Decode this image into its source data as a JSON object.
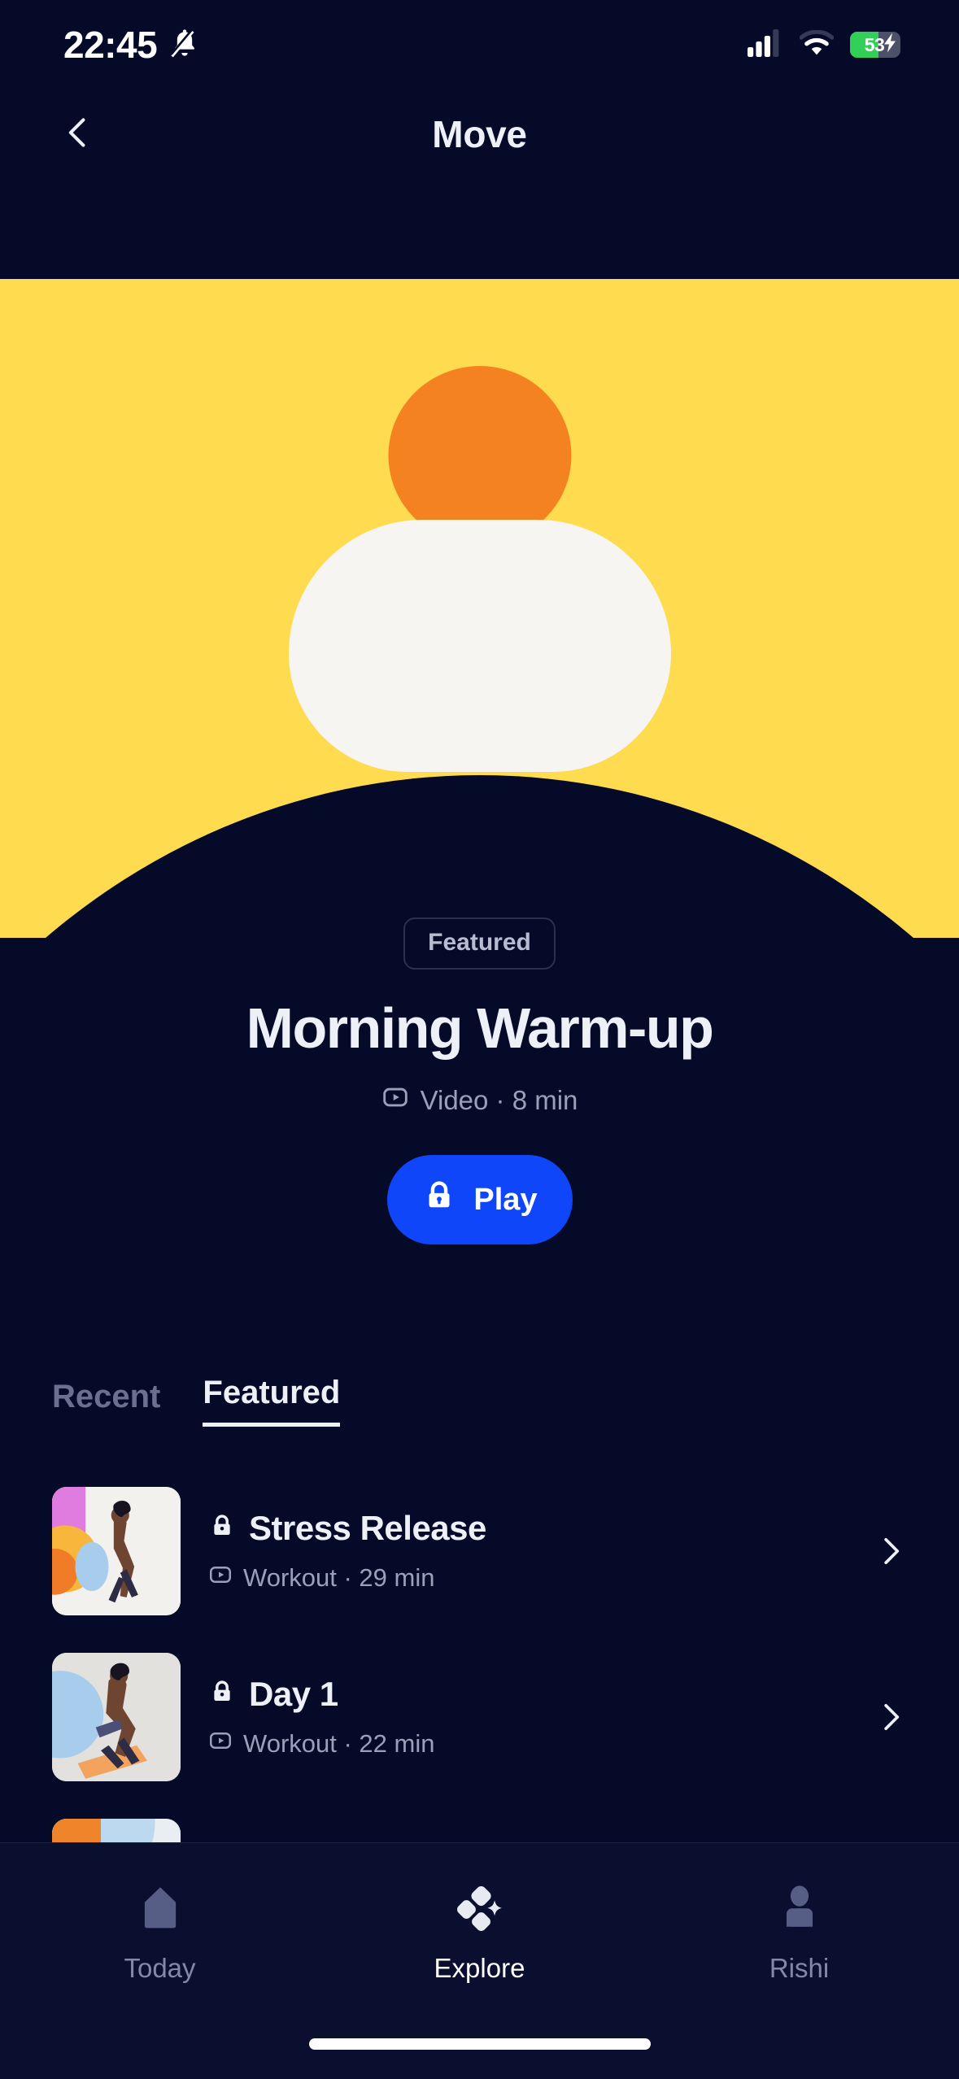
{
  "status_bar": {
    "time": "22:45",
    "bell_icon": "bell-muted-icon",
    "signal_icon": "cellular-signal-icon",
    "wifi_icon": "wifi-icon",
    "battery_percent": "53",
    "battery_charging_icon": "battery-charging-bolt-icon",
    "battery_fill_color": "#31d158"
  },
  "nav": {
    "back_icon": "chevron-left-icon",
    "title": "Move"
  },
  "hero": {
    "background_color": "#fedb4f",
    "head_color": "#f58220",
    "body_color": "#f6f5f1",
    "shadow_color": "#fcc717",
    "illustration": "meditating-figure-illustration"
  },
  "feature": {
    "badge": "Featured",
    "title": "Morning Warm-up",
    "meta_icon": "video-play-box-icon",
    "meta": "Video · 8 min",
    "play_lock_icon": "lock-icon",
    "play_label": "Play",
    "play_color": "#1046fa"
  },
  "tabs": {
    "items": [
      {
        "label": "Recent",
        "active": false
      },
      {
        "label": "Featured",
        "active": true
      }
    ]
  },
  "list": {
    "rows": [
      {
        "lock_icon": "lock-icon",
        "title": "Stress Release",
        "meta_icon": "video-play-box-icon",
        "meta": "Workout · 29 min",
        "chevron_icon": "chevron-right-icon",
        "thumbnail": "woman-exercising-colorful-shapes-thumbnail"
      },
      {
        "lock_icon": "lock-icon",
        "title": "Day 1",
        "meta_icon": "video-play-box-icon",
        "meta": "Workout · 22 min",
        "chevron_icon": "chevron-right-icon",
        "thumbnail": "woman-stretching-blue-circle-thumbnail"
      },
      {
        "lock_icon": "lock-icon",
        "title": "",
        "meta_icon": "video-play-box-icon",
        "meta": "",
        "chevron_icon": "chevron-right-icon",
        "thumbnail": "orange-blue-abstract-thumbnail"
      }
    ]
  },
  "tabbar": {
    "items": [
      {
        "label": "Today",
        "icon": "home-icon",
        "active": false
      },
      {
        "label": "Explore",
        "icon": "sparkle-diamonds-icon",
        "active": true
      },
      {
        "label": "Rishi",
        "icon": "person-icon",
        "active": false
      }
    ]
  }
}
